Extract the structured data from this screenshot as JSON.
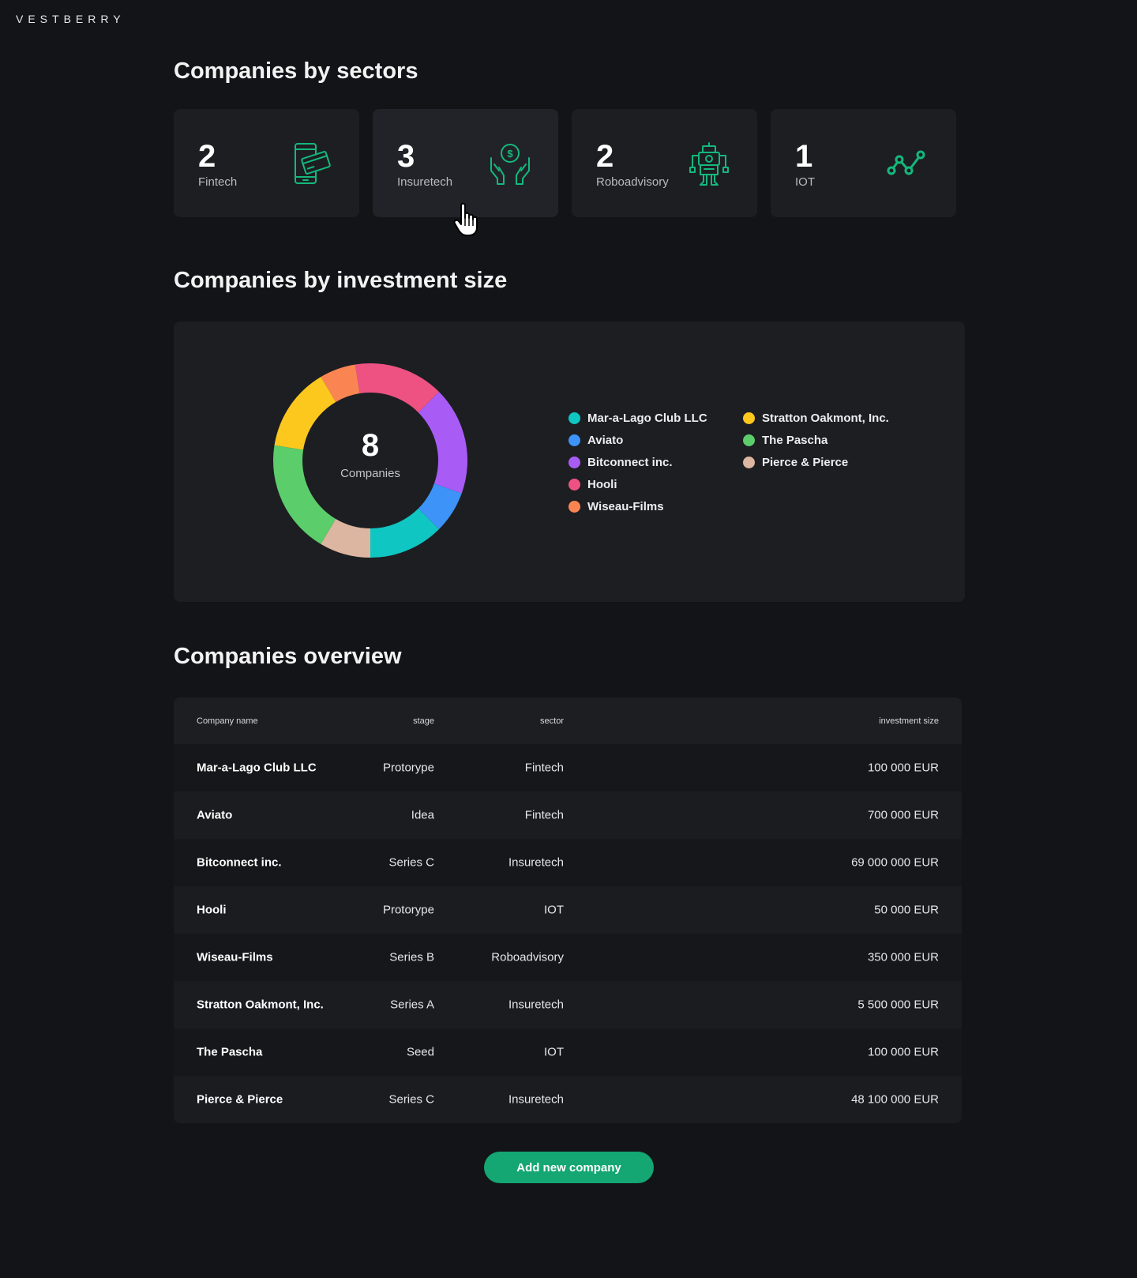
{
  "brand": "VESTBERRY",
  "sectors": {
    "title": "Companies by sectors",
    "cards": [
      {
        "count": "2",
        "label": "Fintech",
        "icon": "phone-card-icon"
      },
      {
        "count": "3",
        "label": "Insuretech",
        "icon": "hands-coin-icon"
      },
      {
        "count": "2",
        "label": "Roboadvisory",
        "icon": "robot-icon"
      },
      {
        "count": "1",
        "label": "IOT",
        "icon": "line-graph-icon"
      }
    ]
  },
  "investment": {
    "title": "Companies by investment size",
    "center_value": "8",
    "center_label": "Companies"
  },
  "chart_data": {
    "type": "pie",
    "categories": [
      "Mar-a-Lago Club LLC",
      "Aviato",
      "Bitconnect inc.",
      "Hooli",
      "Wiseau-Films",
      "Stratton Oakmont, Inc.",
      "The Pascha",
      "Pierce & Pierce"
    ],
    "values": [
      12.5,
      7,
      18,
      15,
      6,
      14,
      19,
      8.5
    ],
    "colors": [
      "#0fc6c2",
      "#3d93f7",
      "#a85cf5",
      "#ee5283",
      "#fb8552",
      "#fcc81e",
      "#5ccd6b",
      "#dcb6a1"
    ],
    "center_text": "8",
    "legend_position": "right"
  },
  "overview": {
    "title": "Companies overview",
    "columns": {
      "name": "Company name",
      "stage": "stage",
      "sector": "sector",
      "investment": "investment size"
    },
    "rows": [
      {
        "name": "Mar-a-Lago Club LLC",
        "stage": "Protorype",
        "sector": "Fintech",
        "investment": "100 000 EUR"
      },
      {
        "name": "Aviato",
        "stage": "Idea",
        "sector": "Fintech",
        "investment": "700 000 EUR"
      },
      {
        "name": "Bitconnect inc.",
        "stage": "Series C",
        "sector": "Insuretech",
        "investment": "69 000 000 EUR"
      },
      {
        "name": "Hooli",
        "stage": "Protorype",
        "sector": "IOT",
        "investment": "50 000 EUR"
      },
      {
        "name": "Wiseau-Films",
        "stage": "Series B",
        "sector": "Roboadvisory",
        "investment": "350 000 EUR"
      },
      {
        "name": "Stratton Oakmont, Inc.",
        "stage": "Series A",
        "sector": "Insuretech",
        "investment": "5 500 000 EUR"
      },
      {
        "name": "The Pascha",
        "stage": "Seed",
        "sector": "IOT",
        "investment": "100 000 EUR"
      },
      {
        "name": "Pierce & Pierce",
        "stage": "Series C",
        "sector": "Insuretech",
        "investment": "48 100 000 EUR"
      }
    ]
  },
  "add_button_label": "Add new company",
  "accent_color": "#14a673"
}
